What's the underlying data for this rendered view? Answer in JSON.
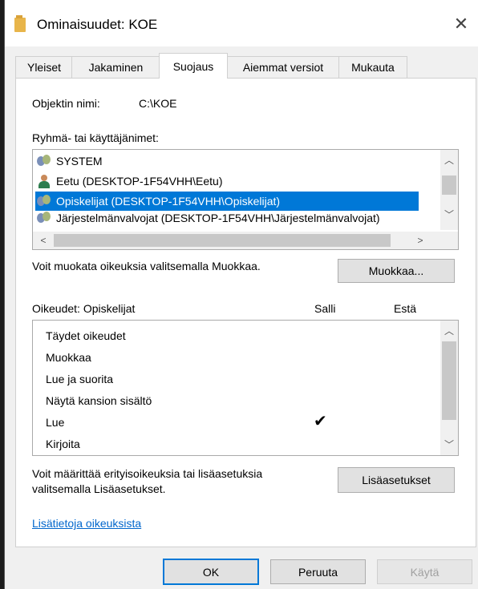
{
  "window": {
    "title": "Ominaisuudet: KOE",
    "close_glyph": "✕"
  },
  "tabs": [
    {
      "label": "Yleiset"
    },
    {
      "label": "Jakaminen"
    },
    {
      "label": "Suojaus"
    },
    {
      "label": "Aiemmat versiot"
    },
    {
      "label": "Mukauta"
    }
  ],
  "active_tab": "Suojaus",
  "object": {
    "label": "Objektin nimi:",
    "value": "C:\\KOE"
  },
  "groups": {
    "label": "Ryhmä- tai käyttäjänimet:",
    "items": [
      {
        "name": "SYSTEM",
        "icon": "group-icon"
      },
      {
        "name": "Eetu (DESKTOP-1F54VHH\\Eetu)",
        "icon": "user-icon"
      },
      {
        "name": "Opiskelijat (DESKTOP-1F54VHH\\Opiskelijat)",
        "icon": "group-icon",
        "selected": true
      },
      {
        "name": "Järjestelmänvalvojat (DESKTOP-1F54VHH\\Järjestelmänvalvojat)",
        "icon": "group-icon"
      }
    ]
  },
  "edit": {
    "text": "Voit muokata oikeuksia valitsemalla Muokkaa.",
    "button": "Muokkaa..."
  },
  "permissions": {
    "label": "Oikeudet: Opiskelijat",
    "col_allow": "Salli",
    "col_deny": "Estä",
    "items": [
      {
        "name": "Täydet oikeudet",
        "allow": false,
        "deny": false
      },
      {
        "name": "Muokkaa",
        "allow": false,
        "deny": false
      },
      {
        "name": "Lue ja suorita",
        "allow": false,
        "deny": false
      },
      {
        "name": "Näytä kansion sisältö",
        "allow": false,
        "deny": false
      },
      {
        "name": "Lue",
        "allow": true,
        "deny": false
      },
      {
        "name": "Kirjoita",
        "allow": false,
        "deny": false
      }
    ],
    "check_glyph": "✔"
  },
  "advanced": {
    "text_line1": "Voit määrittää erityisoikeuksia tai lisäasetuksia",
    "text_line2": "valitsemalla Lisäasetukset.",
    "button": "Lisäasetukset"
  },
  "help_link": "Lisätietoja oikeuksista",
  "footer": {
    "ok": "OK",
    "cancel": "Peruuta",
    "apply": "Käytä"
  },
  "scroll_glyphs": {
    "up": "︿",
    "down": "﹀",
    "left": "<",
    "right": ">"
  }
}
